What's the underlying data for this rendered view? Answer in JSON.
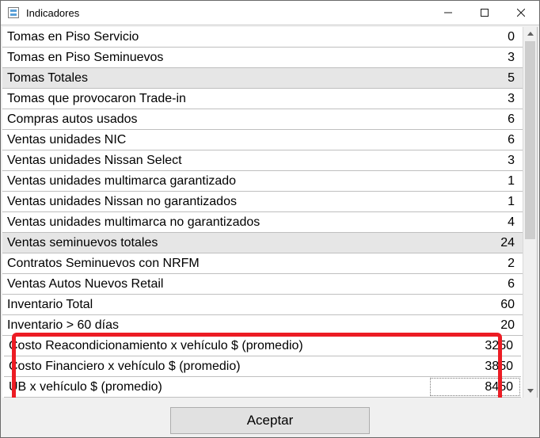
{
  "window": {
    "title": "Indicadores"
  },
  "grid": {
    "rows": [
      {
        "label": "Tomas en Piso Servicio",
        "value": "0",
        "shaded": false
      },
      {
        "label": "Tomas en Piso Seminuevos",
        "value": "3",
        "shaded": false
      },
      {
        "label": "Tomas Totales",
        "value": "5",
        "shaded": true
      },
      {
        "label": "Tomas que provocaron Trade-in",
        "value": "3",
        "shaded": false
      },
      {
        "label": "Compras autos usados",
        "value": "6",
        "shaded": false
      },
      {
        "label": "Ventas unidades NIC",
        "value": "6",
        "shaded": false
      },
      {
        "label": "Ventas unidades Nissan Select",
        "value": "3",
        "shaded": false
      },
      {
        "label": "Ventas unidades multimarca garantizado",
        "value": "1",
        "shaded": false
      },
      {
        "label": "Ventas unidades Nissan no garantizados",
        "value": "1",
        "shaded": false
      },
      {
        "label": "Ventas unidades multimarca no garantizados",
        "value": "4",
        "shaded": false
      },
      {
        "label": "Ventas seminuevos totales",
        "value": "24",
        "shaded": true
      },
      {
        "label": "Contratos Seminuevos con NRFM",
        "value": "2",
        "shaded": false
      },
      {
        "label": "Ventas Autos Nuevos Retail",
        "value": "6",
        "shaded": false
      },
      {
        "label": "Inventario Total",
        "value": "60",
        "shaded": false
      },
      {
        "label": "Inventario > 60 días",
        "value": "20",
        "shaded": false
      }
    ],
    "highlight_rows": [
      {
        "label": "Costo Reacondicionamiento x vehículo $ (promedio)",
        "value": "3250",
        "editing": false
      },
      {
        "label": "Costo Financiero x vehículo $ (promedio)",
        "value": "3850",
        "editing": false
      },
      {
        "label": "UB x vehículo $ (promedio)",
        "value": "8450",
        "editing": true
      }
    ]
  },
  "footer": {
    "accept_label": "Aceptar"
  }
}
